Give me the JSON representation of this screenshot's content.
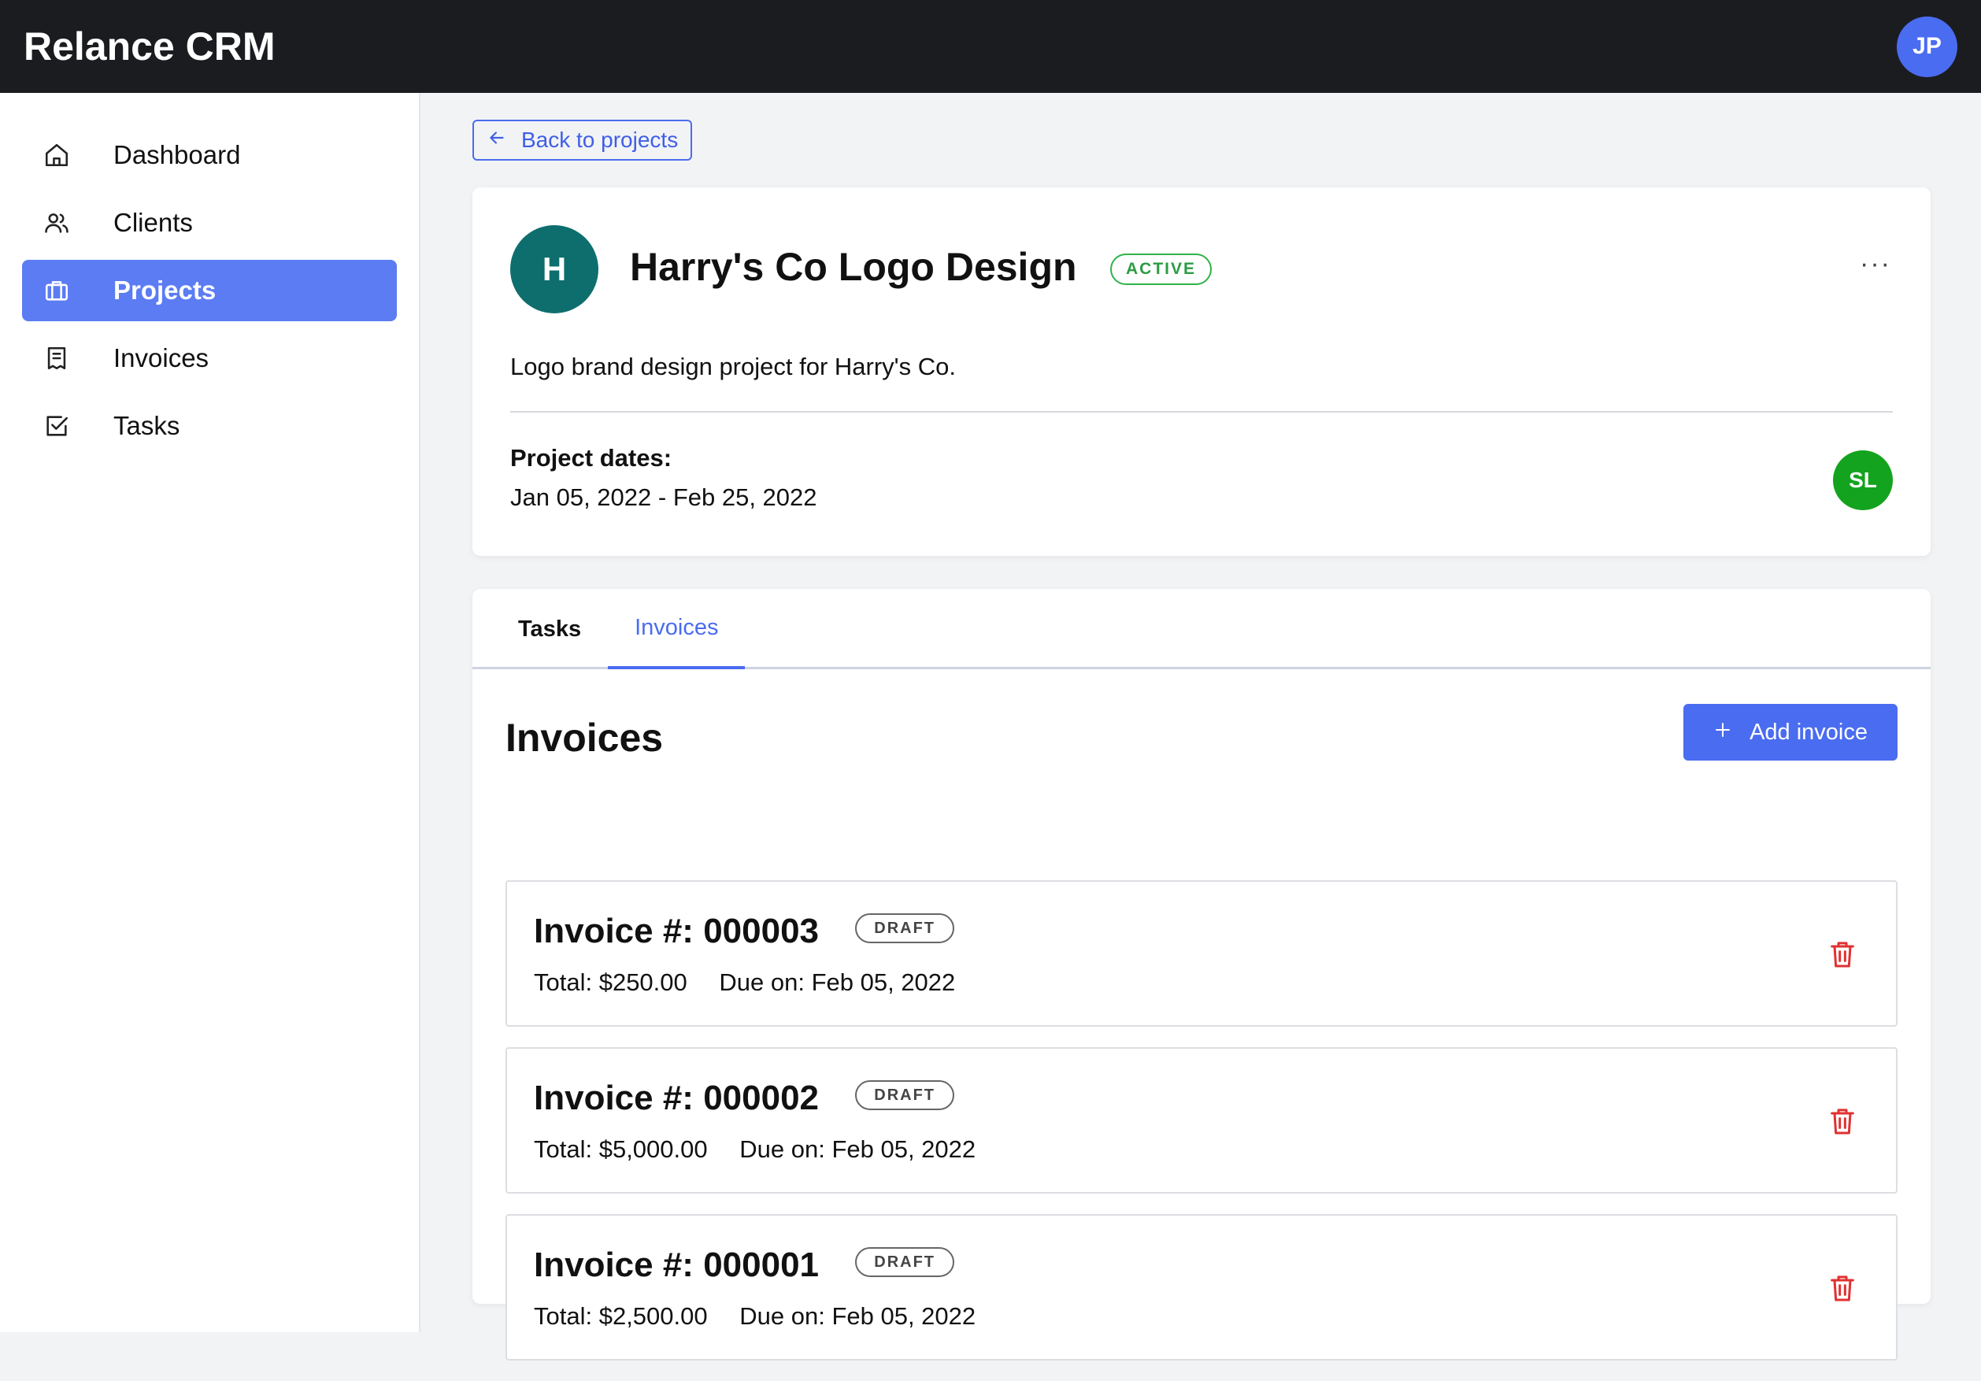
{
  "app": {
    "title": "Relance CRM",
    "user_initials": "JP"
  },
  "sidebar": {
    "items": [
      {
        "label": "Dashboard",
        "icon": "home-icon",
        "active": false
      },
      {
        "label": "Clients",
        "icon": "users-icon",
        "active": false
      },
      {
        "label": "Projects",
        "icon": "briefcase-icon",
        "active": true
      },
      {
        "label": "Invoices",
        "icon": "receipt-icon",
        "active": false
      },
      {
        "label": "Tasks",
        "icon": "checkbox-icon",
        "active": false
      }
    ]
  },
  "back_button": {
    "label": "Back to projects"
  },
  "project": {
    "initial": "H",
    "title": "Harry's Co Logo Design",
    "status": "ACTIVE",
    "description": "Logo brand design project for Harry's Co.",
    "dates_label": "Project dates:",
    "dates_value": "Jan 05, 2022 - Feb 25, 2022",
    "member_initials": "SL",
    "more_label": "···"
  },
  "tabs": [
    {
      "label": "Tasks",
      "active": false
    },
    {
      "label": "Invoices",
      "active": true
    }
  ],
  "invoices_section": {
    "heading": "Invoices",
    "add_button_label": "Add invoice",
    "items": [
      {
        "title": "Invoice #: 000003",
        "status": "DRAFT",
        "total": "Total: $250.00",
        "due": "Due on: Feb 05, 2022"
      },
      {
        "title": "Invoice #: 000002",
        "status": "DRAFT",
        "total": "Total: $5,000.00",
        "due": "Due on: Feb 05, 2022"
      },
      {
        "title": "Invoice #: 000001",
        "status": "DRAFT",
        "total": "Total: $2,500.00",
        "due": "Due on: Feb 05, 2022"
      }
    ]
  },
  "colors": {
    "accent": "#4a6cf0",
    "topbar": "#1b1c20",
    "active_status": "#2a9d43",
    "danger": "#e03131",
    "project_avatar": "#0e6e6e",
    "member_avatar": "#14a31e"
  }
}
